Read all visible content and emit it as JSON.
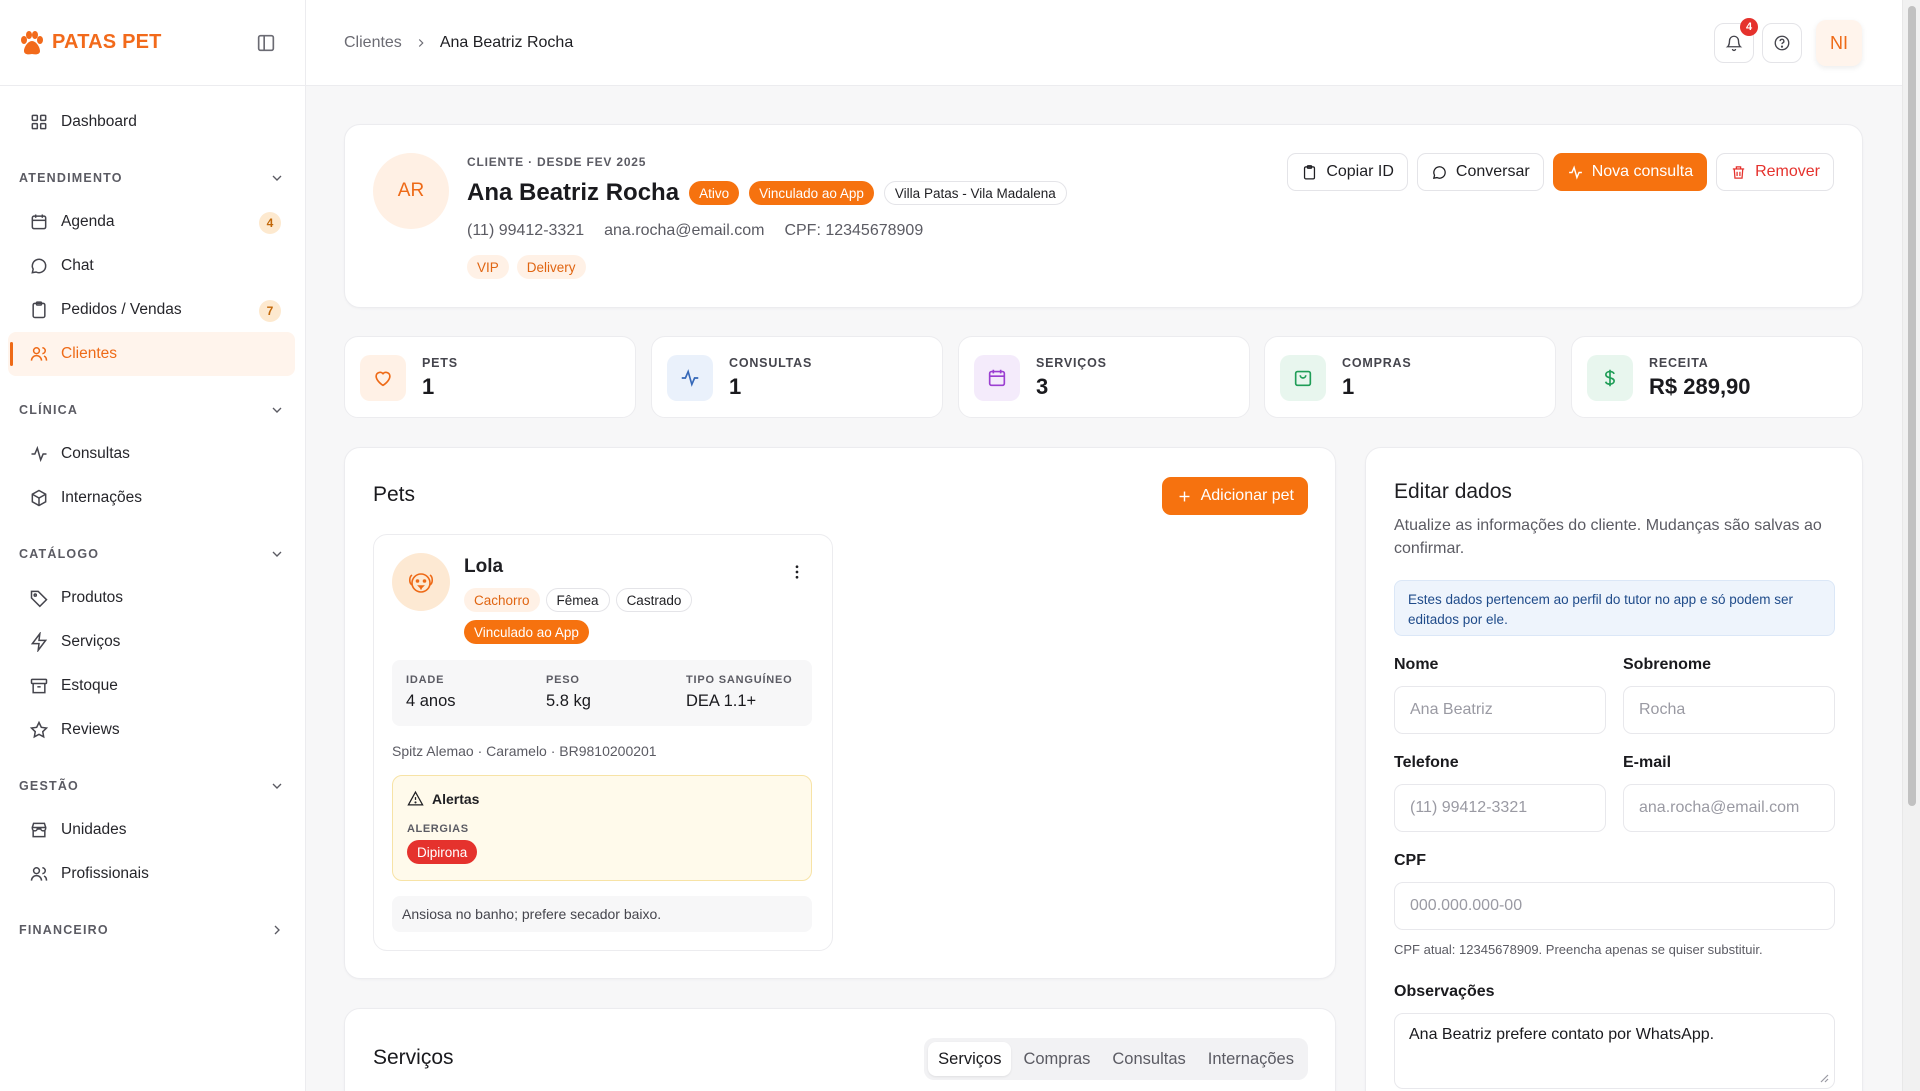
{
  "brand": {
    "name": "PATAS PET"
  },
  "sidebar": {
    "dashboard": "Dashboard",
    "sections": {
      "atendimento": "ATENDIMENTO",
      "clinica": "CLÍNICA",
      "catalogo": "CATÁLOGO",
      "gestao": "GESTÃO",
      "financeiro": "FINANCEIRO"
    },
    "items": {
      "agenda": {
        "label": "Agenda",
        "badge": "4"
      },
      "chat": {
        "label": "Chat"
      },
      "pedidos": {
        "label": "Pedidos / Vendas",
        "badge": "7"
      },
      "clientes": {
        "label": "Clientes"
      },
      "consultas": {
        "label": "Consultas"
      },
      "internacoes": {
        "label": "Internações"
      },
      "produtos": {
        "label": "Produtos"
      },
      "servicos": {
        "label": "Serviços"
      },
      "estoque": {
        "label": "Estoque"
      },
      "reviews": {
        "label": "Reviews"
      },
      "unidades": {
        "label": "Unidades"
      },
      "profissionais": {
        "label": "Profissionais"
      }
    }
  },
  "topbar": {
    "breadcrumb": [
      "Clientes",
      "Ana Beatriz Rocha"
    ],
    "notifications": "4",
    "user_initials": "NI"
  },
  "client": {
    "initials": "AR",
    "kicker": "CLIENTE · DESDE FEV 2025",
    "name": "Ana Beatriz Rocha",
    "status": "Ativo",
    "app_link": "Vinculado ao App",
    "unit": "Villa Patas - Vila Madalena",
    "phone": "(11) 99412-3321",
    "email": "ana.rocha@email.com",
    "cpf": "CPF: 12345678909",
    "tags": [
      "VIP",
      "Delivery"
    ],
    "actions": {
      "copy": "Copiar ID",
      "chat": "Conversar",
      "new": "Nova consulta",
      "remove": "Remover"
    }
  },
  "stats": [
    {
      "label": "PETS",
      "value": "1",
      "icon": "heart-icon",
      "bg": "#fff1e6",
      "fg": "#ee6a17"
    },
    {
      "label": "CONSULTAS",
      "value": "1",
      "icon": "activity-icon",
      "bg": "#eaf1fb",
      "fg": "#3568b8"
    },
    {
      "label": "SERVIÇOS",
      "value": "3",
      "icon": "calendar-icon",
      "bg": "#f4ebfb",
      "fg": "#9b3fd1"
    },
    {
      "label": "COMPRAS",
      "value": "1",
      "icon": "shopping-bag-icon",
      "bg": "#e8f6ee",
      "fg": "#1f9d57"
    },
    {
      "label": "RECEITA",
      "value": "R$ 289,90",
      "icon": "dollar-icon",
      "bg": "#e8f6ee",
      "fg": "#1f9d57"
    }
  ],
  "pets_section": {
    "title": "Pets",
    "add_label": "Adicionar pet",
    "pet": {
      "name": "Lola",
      "species": "Cachorro",
      "sex": "Fêmea",
      "neutered": "Castrado",
      "app_link": "Vinculado ao App",
      "stats": [
        {
          "label": "IDADE",
          "value": "4 anos"
        },
        {
          "label": "PESO",
          "value": "5.8 kg"
        },
        {
          "label": "TIPO SANGUÍNEO",
          "value": "DEA 1.1+"
        }
      ],
      "breed_line": "Spitz Alemao · Caramelo · BR9810200201",
      "alerts_title": "Alertas",
      "allergies_label": "ALERGIAS",
      "allergy": "Dipirona",
      "note": "Ansiosa no banho; prefere secador baixo."
    }
  },
  "services_section": {
    "title": "Serviços",
    "tabs": [
      "Serviços",
      "Compras",
      "Consultas",
      "Internações"
    ]
  },
  "edit": {
    "title": "Editar dados",
    "subtitle": "Atualize as informações do cliente. Mudanças são salvas ao confirmar.",
    "info": "Estes dados pertencem ao perfil do tutor no app e só podem ser editados por ele.",
    "labels": {
      "nome": "Nome",
      "sobrenome": "Sobrenome",
      "telefone": "Telefone",
      "email": "E-mail",
      "cpf": "CPF",
      "obs": "Observações"
    },
    "placeholders": {
      "nome": "Ana Beatriz",
      "sobrenome": "Rocha",
      "telefone": "(11) 99412-3321",
      "email": "ana.rocha@email.com",
      "cpf": "000.000.000-00"
    },
    "cpf_help": "CPF atual: 12345678909. Preencha apenas se quiser substituir.",
    "obs_value": "Ana Beatriz prefere contato por WhatsApp."
  }
}
